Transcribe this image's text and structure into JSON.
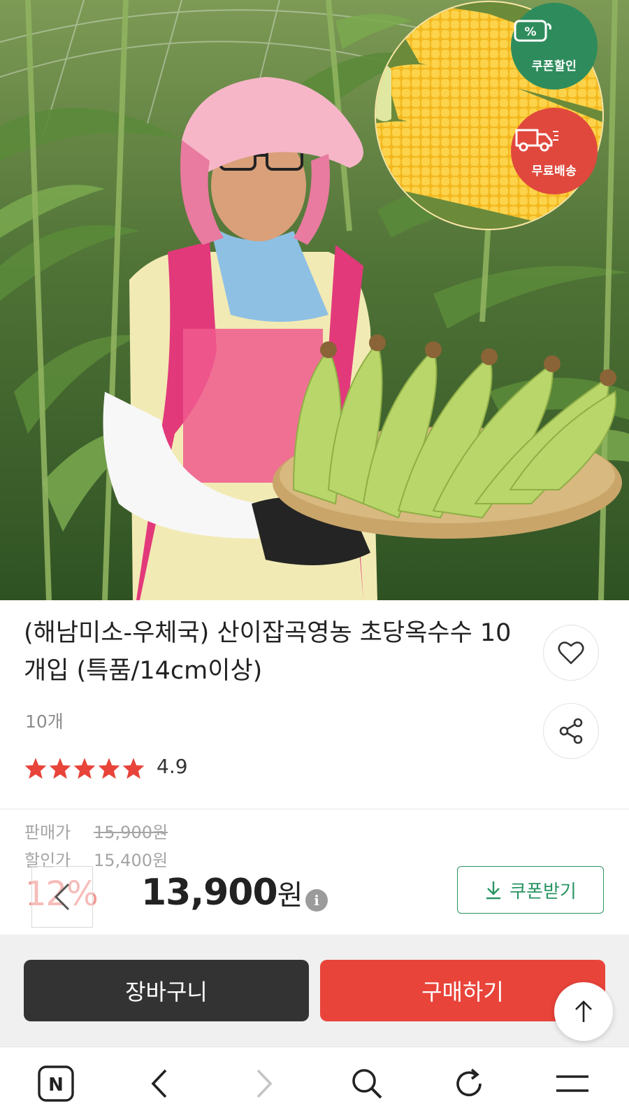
{
  "hero": {
    "badges": [
      {
        "label": "쿠폰할인",
        "icon": "percent-coupon-icon",
        "color": "#2e8c5c"
      },
      {
        "label": "무료배송",
        "icon": "delivery-truck-icon",
        "color": "#e0483d"
      }
    ],
    "coupon_symbol": "%"
  },
  "product": {
    "title": "(해남미소-우체국) 산이잡곡영농 초당옥수수 10개입 (특품/14cm이상)",
    "option": "10개",
    "rating": 4.9,
    "rating_text": "4.9",
    "star_count": 5,
    "star_color": "#e8443a"
  },
  "prices": {
    "sale_label": "판매가",
    "sale_price": "15,900원",
    "discount_label": "할인가",
    "discount_price": "15,400원",
    "discount_rate": "12%",
    "final_price": "13,900",
    "final_unit": "원",
    "info_symbol": "i",
    "coupon_button": "쿠폰받기"
  },
  "actions": {
    "cart": "장바구니",
    "buy": "구매하기",
    "accent": "#e8443a",
    "dark": "#333333"
  },
  "browser_nav": {
    "items": [
      "naver-home-icon",
      "back-icon",
      "forward-icon",
      "search-icon",
      "refresh-icon",
      "menu-icon"
    ],
    "home_letter": "N"
  }
}
